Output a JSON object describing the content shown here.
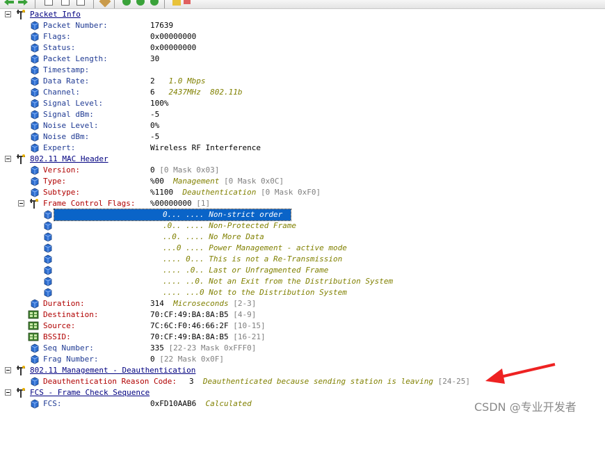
{
  "packet_info": {
    "title": "Packet Info",
    "fields": [
      {
        "name": "Packet Number:",
        "value": "17639",
        "desc": ""
      },
      {
        "name": "Flags:",
        "value": "0x00000000",
        "desc": ""
      },
      {
        "name": "Status:",
        "value": "0x00000000",
        "desc": ""
      },
      {
        "name": "Packet Length:",
        "value": "30",
        "desc": ""
      },
      {
        "name": "Timestamp:",
        "value": "",
        "desc": ""
      },
      {
        "name": "Data Rate:",
        "value": "2",
        "desc": "1.0 Mbps"
      },
      {
        "name": "Channel:",
        "value": "6",
        "desc": "2437MHz  802.11b"
      },
      {
        "name": "Signal Level:",
        "value": "100%",
        "desc": ""
      },
      {
        "name": "Signal dBm:",
        "value": "-5",
        "desc": ""
      },
      {
        "name": "Noise Level:",
        "value": "0%",
        "desc": ""
      },
      {
        "name": "Noise dBm:",
        "value": "-5",
        "desc": ""
      },
      {
        "name": "Expert:",
        "value": "Wireless RF Interference",
        "desc": ""
      }
    ]
  },
  "mac_header": {
    "title": "802.11 MAC Header",
    "version": {
      "name": "Version:",
      "value": "0",
      "range": "[0 Mask 0x03]"
    },
    "type": {
      "name": "Type:",
      "value": "%00",
      "desc": "Management",
      "range": "[0 Mask 0x0C]"
    },
    "subtype": {
      "name": "Subtype:",
      "value": "%1100",
      "desc": "Deauthentication",
      "range": "[0 Mask 0xF0]"
    },
    "fcf": {
      "name": "Frame Control Flags:",
      "value": "%00000000",
      "range": "[1]",
      "bits": [
        "0... .... Non-strict order",
        ".0.. .... Non-Protected Frame",
        "..0. .... No More Data",
        "...0 .... Power Management - active mode",
        ".... 0... This is not a Re-Transmission",
        ".... .0.. Last or Unfragmented Frame",
        ".... ..0. Not an Exit from the Distribution System",
        ".... ...0 Not to the Distribution System"
      ]
    },
    "duration": {
      "name": "Duration:",
      "value": "314",
      "desc": "Microseconds",
      "range": "[2-3]"
    },
    "destination": {
      "name": "Destination:",
      "value": "70:CF:49:BA:8A:B5",
      "range": "[4-9]"
    },
    "source": {
      "name": "Source:",
      "value": "7C:6C:F0:46:66:2F",
      "range": "[10-15]"
    },
    "bssid": {
      "name": "BSSID:",
      "value": "70:CF:49:BA:8A:B5",
      "range": "[16-21]"
    },
    "seq": {
      "name": "Seq Number:",
      "value": "335",
      "range": "[22-23 Mask 0xFFF0]"
    },
    "frag": {
      "name": "Frag Number:",
      "value": "0",
      "range": "[22 Mask 0x0F]"
    }
  },
  "management": {
    "title": "802.11 Management - Deauthentication",
    "reason": {
      "name": "Deauthentication Reason Code:",
      "value": "3",
      "desc": "Deauthenticated because sending station is leaving",
      "range": "[24-25]"
    }
  },
  "fcs": {
    "title": "FCS - Frame Check Sequence",
    "field": {
      "name": "FCS:",
      "value": "0xFD10AAB6",
      "desc": "Calculated"
    }
  },
  "watermark": "CSDN @专业开发者",
  "colors": {
    "field_name_blue": "#1f3a93",
    "field_name_red": "#b00000",
    "desc_olive": "#808000",
    "range_gray": "#808080",
    "header_navy": "#000080",
    "selection": "#0a64c8",
    "arrow": "#ee2222"
  }
}
